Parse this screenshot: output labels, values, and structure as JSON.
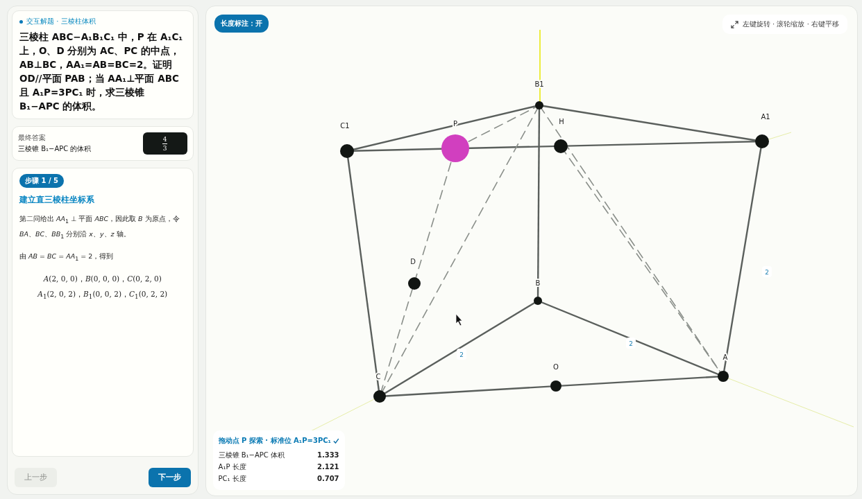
{
  "problem": {
    "tag": "交互解题 · 三棱柱体积",
    "text": "三棱柱 ABC−A₁B₁C₁ 中，P 在 A₁C₁ 上，O、D 分别为 AC、PC 的中点，AB⊥BC，AA₁=AB=BC=2。证明 OD//平面 PAB；当 AA₁⊥平面 ABC 且 A₁P=3PC₁ 时，求三棱锥 B₁−APC 的体积。"
  },
  "answer": {
    "label": "最终答案",
    "subject": "三棱锥 B₁−APC 的体积",
    "numerator": "4",
    "denominator": "3"
  },
  "step": {
    "badge": "步骤 1 / 5",
    "title": "建立直三棱柱坐标系",
    "paragraphs": [
      "第二问给出 *AA*$_{1}$ ⊥ 平面 *ABC*，因此取 *B* 为原点，令 *BA*、*BC*、*BB*$_{1}$ 分别沿 *x*、*y*、*z* 轴。",
      "由 *AB* = *BC* = *AA*$_{1}$ = 2，得到"
    ],
    "formulas": [
      "*A*(2, 0, 0)，*B*(0, 0, 0)，*C*(0, 2, 0)",
      "*A*$_{1}$(2, 0, 2)，*B*$_{1}$(0, 0, 2)，*C*$_{1}$(0, 2, 2)"
    ]
  },
  "nav": [
    {
      "label": "上一步",
      "disabled": true
    },
    {
      "label": "下一步",
      "disabled": false
    }
  ],
  "toggle": {
    "label": "长度标注：开",
    "on": true
  },
  "hint": "左键旋转 · 滚轮缩放 · 右键平移",
  "points": [
    {
      "label": "B1",
      "kind": "vertex"
    },
    {
      "label": "C1",
      "kind": "vertex"
    },
    {
      "label": "P",
      "kind": "draggable"
    },
    {
      "label": "H",
      "kind": "vertex"
    },
    {
      "label": "A1",
      "kind": "vertex"
    },
    {
      "label": "D",
      "kind": "vertex"
    },
    {
      "label": "B",
      "kind": "vertex"
    },
    {
      "label": "C",
      "kind": "vertex"
    },
    {
      "label": "O",
      "kind": "vertex"
    },
    {
      "label": "A",
      "kind": "vertex"
    }
  ],
  "length_labels": [
    "2",
    "2",
    "2"
  ],
  "info": {
    "title": "拖动点 P 探索 · 标准位 A₁P=3PC₁",
    "rows": [
      {
        "name": "三棱锥 B₁−APC 体积",
        "value": "1.333"
      },
      {
        "name": "A₁P 长度",
        "value": "2.121"
      },
      {
        "name": "PC₁ 长度",
        "value": "0.707"
      }
    ]
  }
}
